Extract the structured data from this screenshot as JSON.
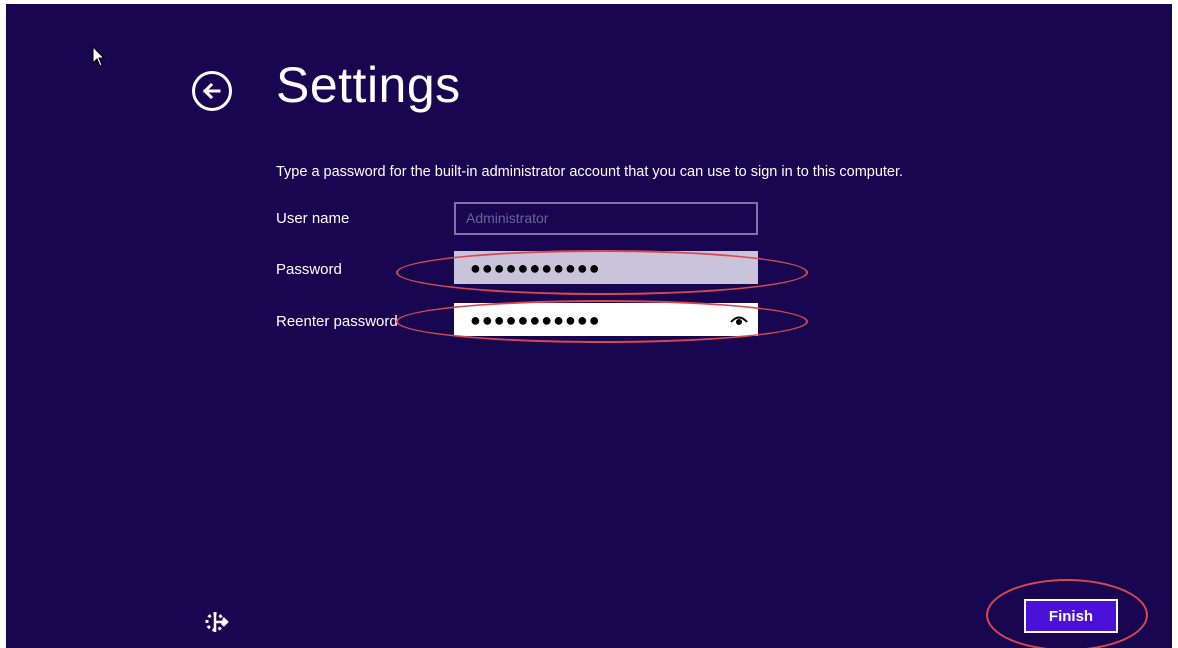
{
  "page": {
    "title": "Settings",
    "instructions": "Type a password for the built-in administrator account that you can use to sign in to this computer."
  },
  "form": {
    "username_label": "User name",
    "username_placeholder": "Administrator",
    "password_label": "Password",
    "password_value": "●●●●●●●●●●●",
    "reenter_label": "Reenter password",
    "reenter_value": "●●●●●●●●●●●"
  },
  "footer": {
    "finish_label": "Finish"
  },
  "icons": {
    "back": "back-arrow-icon",
    "reveal": "eye-icon",
    "accessibility": "ease-of-access-icon",
    "cursor": "mouse-cursor-icon"
  },
  "colors": {
    "background": "#180651",
    "annotation": "#d8494c",
    "button": "#4a11d8"
  }
}
